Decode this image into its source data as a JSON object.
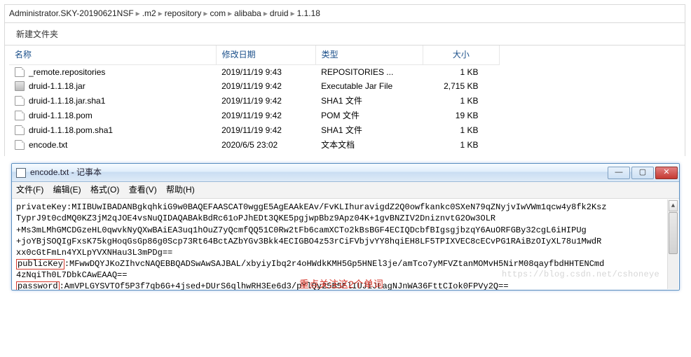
{
  "breadcrumb": {
    "items": [
      "Administrator.SKY-20190621NSF",
      ".m2",
      "repository",
      "com",
      "alibaba",
      "druid",
      "1.1.18"
    ]
  },
  "toolbar": {
    "new_folder_label": "新建文件夹"
  },
  "columns": {
    "name": "名称",
    "date": "修改日期",
    "type": "类型",
    "size": "大小"
  },
  "files": [
    {
      "name": "_remote.repositories",
      "date": "2019/11/19 9:43",
      "type": "REPOSITORIES ...",
      "size": "1 KB",
      "icon": "file"
    },
    {
      "name": "druid-1.1.18.jar",
      "date": "2019/11/19 9:42",
      "type": "Executable Jar File",
      "size": "2,715 KB",
      "icon": "jar"
    },
    {
      "name": "druid-1.1.18.jar.sha1",
      "date": "2019/11/19 9:42",
      "type": "SHA1 文件",
      "size": "1 KB",
      "icon": "file"
    },
    {
      "name": "druid-1.1.18.pom",
      "date": "2019/11/19 9:42",
      "type": "POM 文件",
      "size": "19 KB",
      "icon": "file"
    },
    {
      "name": "druid-1.1.18.pom.sha1",
      "date": "2019/11/19 9:42",
      "type": "SHA1 文件",
      "size": "1 KB",
      "icon": "file"
    },
    {
      "name": "encode.txt",
      "date": "2020/6/5 23:02",
      "type": "文本文档",
      "size": "1 KB",
      "icon": "file"
    }
  ],
  "notepad": {
    "title": "encode.txt - 记事本",
    "menu": {
      "file": "文件(F)",
      "edit": "编辑(E)",
      "format": "格式(O)",
      "view": "查看(V)",
      "help": "帮助(H)"
    },
    "pk_label": "privateKey",
    "pk_l1": ":MIIBUwIBADANBgkqhkiG9w0BAQEFAASCAT0wggE5AgEAAkEAv/FvKLIhuravigdZ2Q0owfkankc0SXeN79qZNyjvIwVWm1qcw4y8fk2Ksz",
    "pk_l2": "TyprJ9t0cdMQ0KZ3jM2qJOE4vsNuQIDAQABAkBdRc61oPJhEDt3QKE5pgjwpBbz9Apz04K+1gvBNZIV2DniznvtG2Ow3OLR",
    "pk_l3": "+Ms3mLMhGMCDGzeHL0qwvkNyQXwBAiEA3uq1hOuZ7yQcmfQQ51C0Rw2tFb6camXCTo2kBsBGF4ECIQDcbfBIgsgjbzqY6AuORFGBy32cgL6iHIPUg",
    "pk_l4": "+joYBjSOQIgFxsK75kgHoqGsGp86g0Scp73Rt64BctAZbYGv3Bkk4ECIGBO4z53rCiFVbjvYY8hqiEH8LF5TPIXVEC8cECvPG1RAiBzOIyXL78u1MwdR",
    "pk_l5": "xx0cGtFmLn4YXLpYVXNHau3L3mPDg==",
    "pub_label": "publicKey",
    "pub_rest": ":MFwwDQYJKoZIhvcNAQEBBQADSwAwSAJBAL/xbyiyIbq2r4oHWdkKMH5Gp5HNEl3je/amTco7yMFVZtanMOMvH5NirM08qayfbdHHTENCmd",
    "pub_l2": "4zNqiTh0L7DbkCAwEAAQ==",
    "pwd_label": "password",
    "pwd_rest": ":AmVPLGYSVTOf5P3f7qb6G+4jsed+DUrS6qlhwRH3Ee6d3/pYlQy25B5ElIUJiJLagNJnWA36FttCIok0FPVy2Q=="
  },
  "annotation": {
    "note": "重点关注这2个单词"
  },
  "watermark": "https://blog.csdn.net/cshoneye"
}
